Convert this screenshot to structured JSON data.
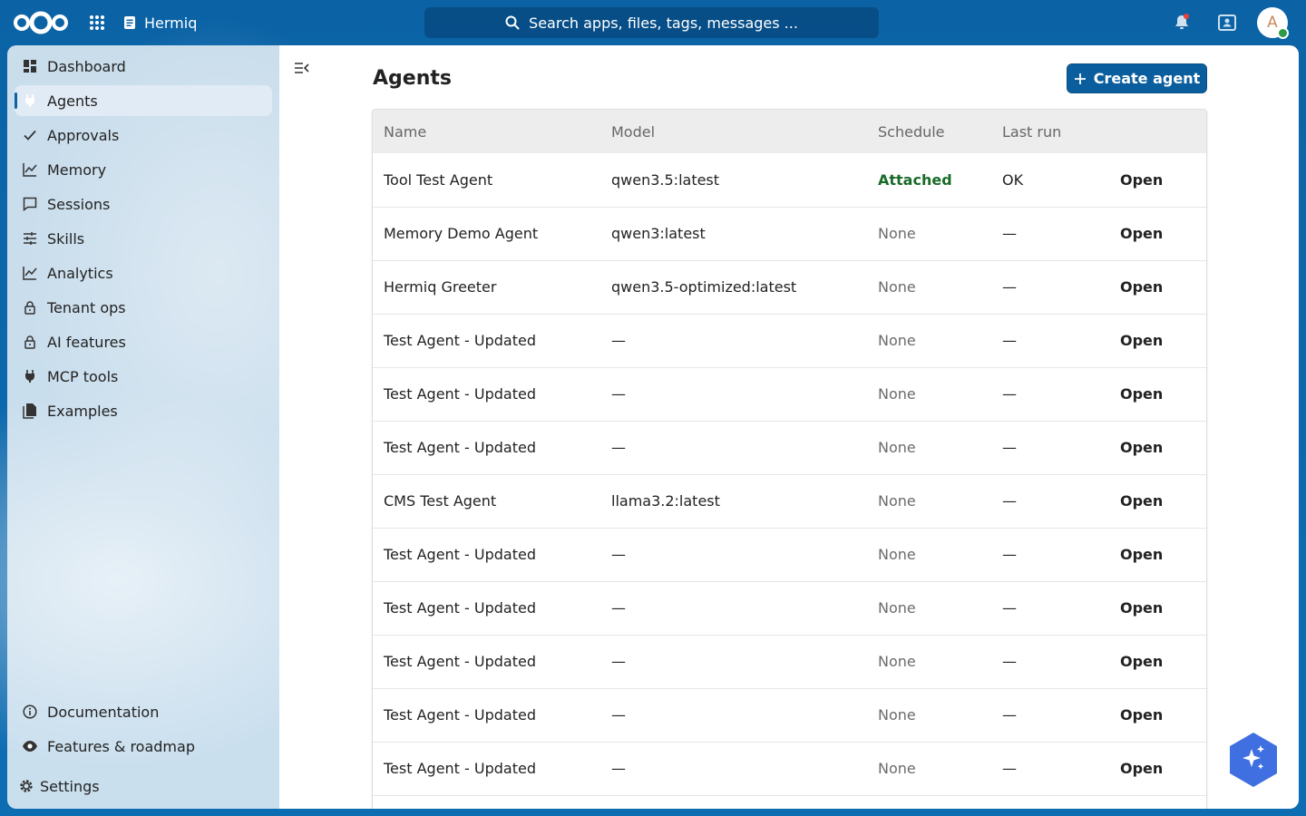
{
  "header": {
    "app_name": "Hermiq",
    "search_placeholder": "Search apps, files, tags, messages ...",
    "avatar_initial": "A"
  },
  "sidebar": {
    "items": [
      {
        "label": "Dashboard",
        "icon": "dashboard-icon"
      },
      {
        "label": "Agents",
        "icon": "plug-icon",
        "active": true
      },
      {
        "label": "Approvals",
        "icon": "check-icon"
      },
      {
        "label": "Memory",
        "icon": "chart-line-icon"
      },
      {
        "label": "Sessions",
        "icon": "chat-icon"
      },
      {
        "label": "Skills",
        "icon": "sliders-icon"
      },
      {
        "label": "Analytics",
        "icon": "chart-line-icon"
      },
      {
        "label": "Tenant ops",
        "icon": "lock-icon"
      },
      {
        "label": "AI features",
        "icon": "lock-icon"
      },
      {
        "label": "MCP tools",
        "icon": "plug-icon"
      },
      {
        "label": "Examples",
        "icon": "documents-icon"
      }
    ],
    "bottom": [
      {
        "label": "Documentation",
        "icon": "info-icon"
      },
      {
        "label": "Features & roadmap",
        "icon": "eye-icon"
      }
    ],
    "settings_label": "Settings"
  },
  "main": {
    "title": "Agents",
    "create_label": "Create agent",
    "columns": [
      "Name",
      "Model",
      "Schedule",
      "Last run",
      ""
    ],
    "rows": [
      {
        "name": "Tool Test Agent",
        "model": "qwen3.5:latest",
        "schedule": "Attached",
        "last_run": "OK",
        "action": "Open"
      },
      {
        "name": "Memory Demo Agent",
        "model": "qwen3:latest",
        "schedule": "None",
        "last_run": "—",
        "action": "Open"
      },
      {
        "name": "Hermiq Greeter",
        "model": "qwen3.5-optimized:latest",
        "schedule": "None",
        "last_run": "—",
        "action": "Open"
      },
      {
        "name": "Test Agent - Updated",
        "model": "—",
        "schedule": "None",
        "last_run": "—",
        "action": "Open"
      },
      {
        "name": "Test Agent - Updated",
        "model": "—",
        "schedule": "None",
        "last_run": "—",
        "action": "Open"
      },
      {
        "name": "Test Agent - Updated",
        "model": "—",
        "schedule": "None",
        "last_run": "—",
        "action": "Open"
      },
      {
        "name": "CMS Test Agent",
        "model": "llama3.2:latest",
        "schedule": "None",
        "last_run": "—",
        "action": "Open"
      },
      {
        "name": "Test Agent - Updated",
        "model": "—",
        "schedule": "None",
        "last_run": "—",
        "action": "Open"
      },
      {
        "name": "Test Agent - Updated",
        "model": "—",
        "schedule": "None",
        "last_run": "—",
        "action": "Open"
      },
      {
        "name": "Test Agent - Updated",
        "model": "—",
        "schedule": "None",
        "last_run": "—",
        "action": "Open"
      },
      {
        "name": "Test Agent - Updated",
        "model": "—",
        "schedule": "None",
        "last_run": "—",
        "action": "Open"
      },
      {
        "name": "Test Agent - Updated",
        "model": "—",
        "schedule": "None",
        "last_run": "—",
        "action": "Open"
      }
    ]
  },
  "colors": {
    "brand": "#0b63a5",
    "attached": "#1a6b2a",
    "assistant": "#3f6fe0"
  }
}
